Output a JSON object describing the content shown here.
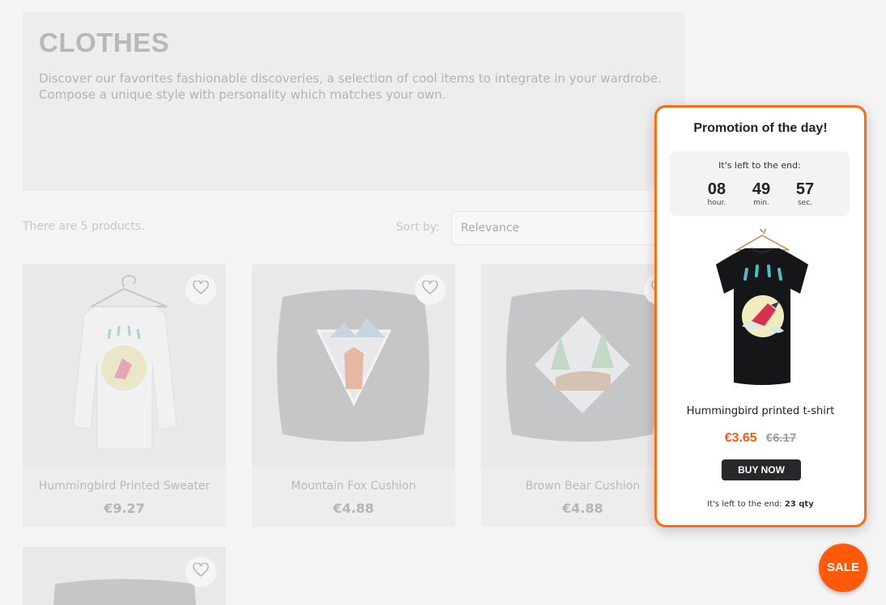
{
  "category": {
    "title": "CLOTHES",
    "description": "Discover our favorites fashionable discoveries, a selection of cool items to integrate in your wardrobe. Compose a unique style with personality which matches your own."
  },
  "listing": {
    "count_text": "There are 5 products.",
    "sort_label": "Sort by:",
    "sort_value": "Relevance"
  },
  "products": [
    {
      "name": "Hummingbird Printed Sweater",
      "price": "€9.27",
      "icon": "heart-outline-icon"
    },
    {
      "name": "Mountain Fox Cushion",
      "price": "€4.88",
      "icon": "heart-outline-icon"
    },
    {
      "name": "Brown Bear Cushion",
      "price": "€4.88",
      "icon": "heart-outline-icon"
    }
  ],
  "promo": {
    "title": "Promotion of the day!",
    "timer_label": "It's left to the end:",
    "hours": "08",
    "hours_label": "hour.",
    "minutes": "49",
    "minutes_label": "min.",
    "seconds": "57",
    "seconds_label": "sec.",
    "product_name": "Hummingbird printed t-shirt",
    "price_new": "€3.65",
    "price_old": "€6.17",
    "buy_label": "BUY NOW",
    "stock_label": "It's left to the end:",
    "stock_qty": "23 qty",
    "accent": "#ff6a14"
  },
  "sale_badge": "SALE"
}
